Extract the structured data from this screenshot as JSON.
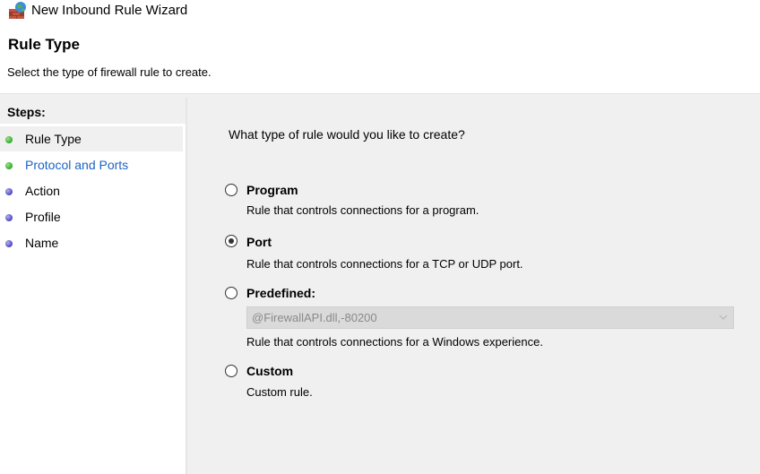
{
  "window": {
    "title": "New Inbound Rule Wizard",
    "icon": "firewall-icon"
  },
  "header": {
    "title": "Rule Type",
    "description": "Select the type of firewall rule to create."
  },
  "steps": {
    "title": "Steps:",
    "items": [
      {
        "label": "Rule Type",
        "state": "current",
        "dot_color": "#2ea82a"
      },
      {
        "label": "Protocol and Ports",
        "state": "link",
        "dot_color": "#2ea82a"
      },
      {
        "label": "Action",
        "state": "pending",
        "dot_color": "#4b45c0"
      },
      {
        "label": "Profile",
        "state": "pending",
        "dot_color": "#4b45c0"
      },
      {
        "label": "Name",
        "state": "pending",
        "dot_color": "#4b45c0"
      }
    ]
  },
  "main": {
    "question": "What type of rule would you like to create?",
    "options": [
      {
        "label": "Program",
        "description": "Rule that controls connections for a program.",
        "selected": false
      },
      {
        "label": "Port",
        "description": "Rule that controls connections for a TCP or UDP port.",
        "selected": true
      },
      {
        "label": "Predefined:",
        "description": "Rule that controls connections for a Windows experience.",
        "selected": false
      },
      {
        "label": "Custom",
        "description": "Custom rule.",
        "selected": false
      }
    ],
    "predefined_select": {
      "value": "@FirewallAPI.dll,-80200",
      "disabled": true
    }
  },
  "colors": {
    "link": "#1a63c7",
    "panel_bg": "#f0f0f0"
  }
}
